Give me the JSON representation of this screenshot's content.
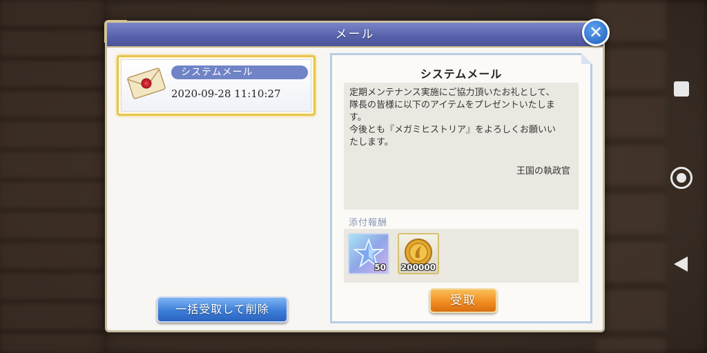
{
  "dialog": {
    "title": "メール",
    "close_icon": "close-icon"
  },
  "mail_list": {
    "items": [
      {
        "name": "システムメール",
        "date": "2020-09-28 11:10:27",
        "icon": "envelope-icon"
      }
    ],
    "bulk_button_label": "一括受取して削除"
  },
  "detail": {
    "title": "システムメール",
    "body_lines": [
      "定期メンテナンス実施にご協力頂いたお礼として、",
      "隊長の皆様に以下のアイテムをプレゼントいたしま",
      "す。",
      "今後とも『メガミヒストリア』をよろしくお願いい",
      "たします。"
    ],
    "signature": "王国の執政官",
    "attachments_label": "添付報酬",
    "attachments": [
      {
        "icon": "star-crystal-icon",
        "quantity": "50"
      },
      {
        "icon": "gold-coin-icon",
        "quantity": "200000"
      }
    ],
    "receive_button_label": "受取"
  },
  "colors": {
    "title_bar": "#5661aa",
    "selected_border": "#e8c44a",
    "blue_button": "#3d7ed8",
    "orange_button": "#f08a1f"
  }
}
